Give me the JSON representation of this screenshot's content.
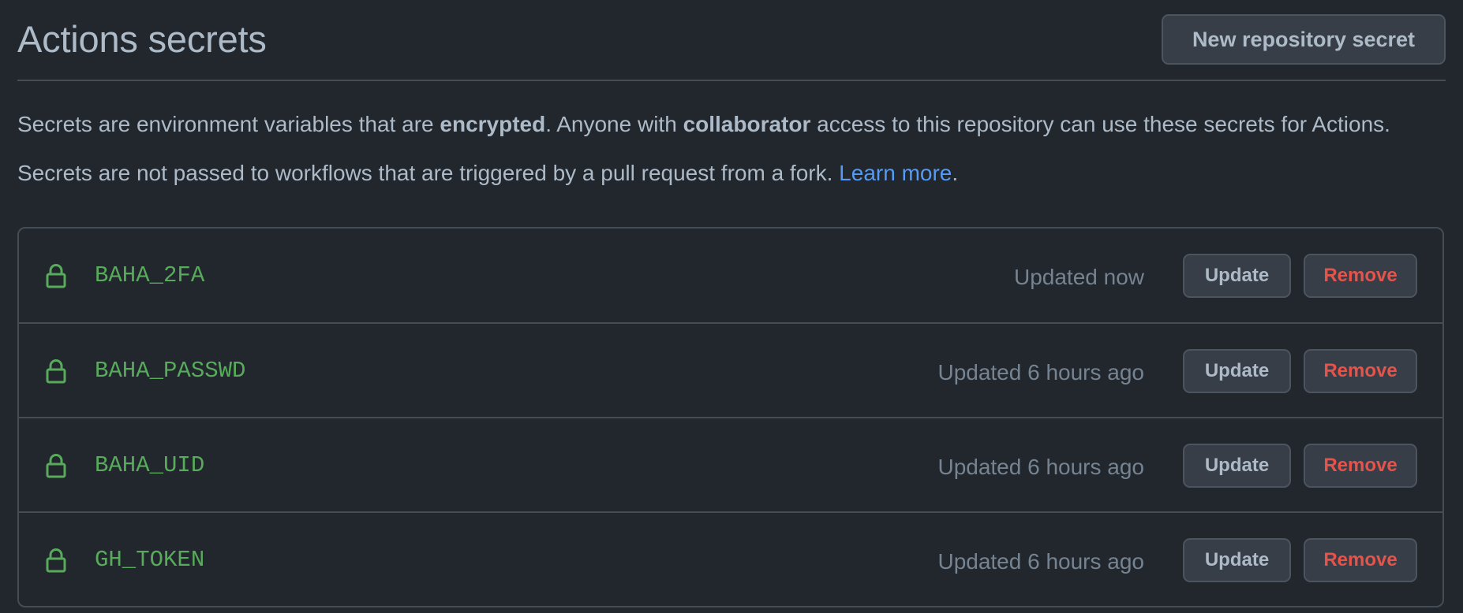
{
  "header": {
    "title": "Actions secrets",
    "new_secret_label": "New repository secret"
  },
  "description": {
    "line1_prefix": "Secrets are environment variables that are ",
    "line1_bold1": "encrypted",
    "line1_mid": ". Anyone with ",
    "line1_bold2": "collaborator",
    "line1_suffix": " access to this repository can use these secrets for Actions.",
    "line2_prefix": "Secrets are not passed to workflows that are triggered by a pull request from a fork. ",
    "line2_link": "Learn more",
    "line2_suffix": "."
  },
  "secrets": [
    {
      "icon": "lock-icon",
      "name": "BAHA_2FA",
      "updated": "Updated now",
      "update_label": "Update",
      "remove_label": "Remove"
    },
    {
      "icon": "lock-icon",
      "name": "BAHA_PASSWD",
      "updated": "Updated 6 hours ago",
      "update_label": "Update",
      "remove_label": "Remove"
    },
    {
      "icon": "lock-icon",
      "name": "BAHA_UID",
      "updated": "Updated 6 hours ago",
      "update_label": "Update",
      "remove_label": "Remove"
    },
    {
      "icon": "lock-icon",
      "name": "GH_TOKEN",
      "updated": "Updated 6 hours ago",
      "update_label": "Update",
      "remove_label": "Remove"
    }
  ],
  "colors": {
    "background": "#22272e",
    "text": "#adbac7",
    "muted": "#768390",
    "secret_name": "#57ab5a",
    "danger": "#e5534b",
    "link": "#539bf5",
    "border": "#444c56"
  }
}
